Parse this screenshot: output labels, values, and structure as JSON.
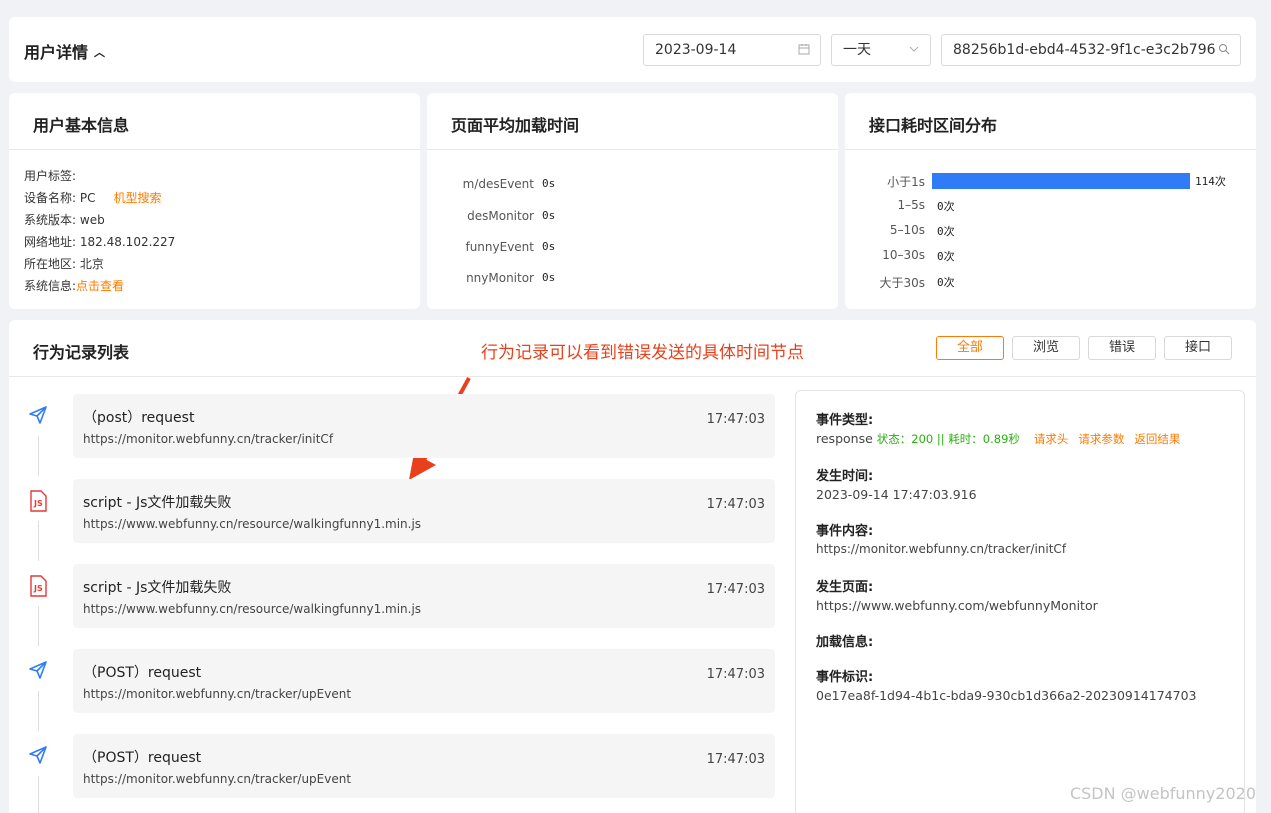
{
  "header": {
    "title": "用户详情",
    "date_value": "2023-09-14",
    "range_value": "一天",
    "user_id_value": "88256b1d-ebd4-4532-9f1c-e3c2b796"
  },
  "basic_info": {
    "title": "用户基本信息",
    "tag_label": "用户标签:",
    "device_label": "设备名称:",
    "device_value": "PC",
    "device_link": "机型搜索",
    "os_label": "系统版本:",
    "os_value": "web",
    "ip_label": "网络地址:",
    "ip_value": "182.48.102.227",
    "region_label": "所在地区:",
    "region_value": "北京",
    "sysinfo_label": "系统信息:",
    "sysinfo_link": "点击查看"
  },
  "load_time": {
    "title": "页面平均加载时间",
    "rows": [
      {
        "label": "m/desEvent",
        "value": "0s"
      },
      {
        "label": "desMonitor",
        "value": "0s"
      },
      {
        "label": "funnyEvent",
        "value": "0s"
      },
      {
        "label": "nnyMonitor",
        "value": "0s"
      }
    ]
  },
  "api_dist": {
    "title": "接口耗时区间分布",
    "max": 114,
    "rows": [
      {
        "label": "小于1s",
        "count": 114,
        "text": "114次"
      },
      {
        "label": "1–5s",
        "count": 0,
        "text": "0次"
      },
      {
        "label": "5–10s",
        "count": 0,
        "text": "0次"
      },
      {
        "label": "10–30s",
        "count": 0,
        "text": "0次"
      },
      {
        "label": "大于30s",
        "count": 0,
        "text": "0次"
      }
    ]
  },
  "behavior": {
    "title": "行为记录列表",
    "annotation": "行为记录可以看到错误发送的具体时间节点",
    "filters": [
      "全部",
      "浏览",
      "错误",
      "接口"
    ],
    "active_filter": "全部",
    "events": [
      {
        "icon": "send-icon",
        "title": "（post）request",
        "url": "https://monitor.webfunny.cn/tracker/initCf",
        "time": "17:47:03"
      },
      {
        "icon": "js-file-icon",
        "title": "script - Js文件加载失败",
        "url": "https://www.webfunny.cn/resource/walkingfunny1.min.js",
        "time": "17:47:03"
      },
      {
        "icon": "js-file-icon",
        "title": "script - Js文件加载失败",
        "url": "https://www.webfunny.cn/resource/walkingfunny1.min.js",
        "time": "17:47:03"
      },
      {
        "icon": "send-icon",
        "title": "（POST）request",
        "url": "https://monitor.webfunny.cn/tracker/upEvent",
        "time": "17:47:03"
      },
      {
        "icon": "send-icon",
        "title": "（POST）request",
        "url": "https://monitor.webfunny.cn/tracker/upEvent",
        "time": "17:47:03"
      }
    ]
  },
  "detail": {
    "type_head": "事件类型:",
    "type_value": "response",
    "status_text": "状态：200 || 耗时：0.89秒",
    "links": [
      "请求头",
      "请求参数",
      "返回结果"
    ],
    "time_head": "发生时间:",
    "time_value": "2023-09-14 17:47:03.916",
    "content_head": "事件内容:",
    "content_value": "https://monitor.webfunny.cn/tracker/initCf",
    "page_head": "发生页面:",
    "page_value": "https://www.webfunny.com/webfunnyMonitor",
    "load_head": "加载信息:",
    "id_head": "事件标识:",
    "id_value": "0e17ea8f-1d94-4b1c-bda9-930cb1d366a2-20230914174703"
  },
  "colors": {
    "accent": "#2f7cf6",
    "orange": "#ff7a00",
    "green": "#29b010",
    "annotation": "#e8401c",
    "error": "#e53935"
  },
  "watermark": "CSDN @webfunny2020"
}
